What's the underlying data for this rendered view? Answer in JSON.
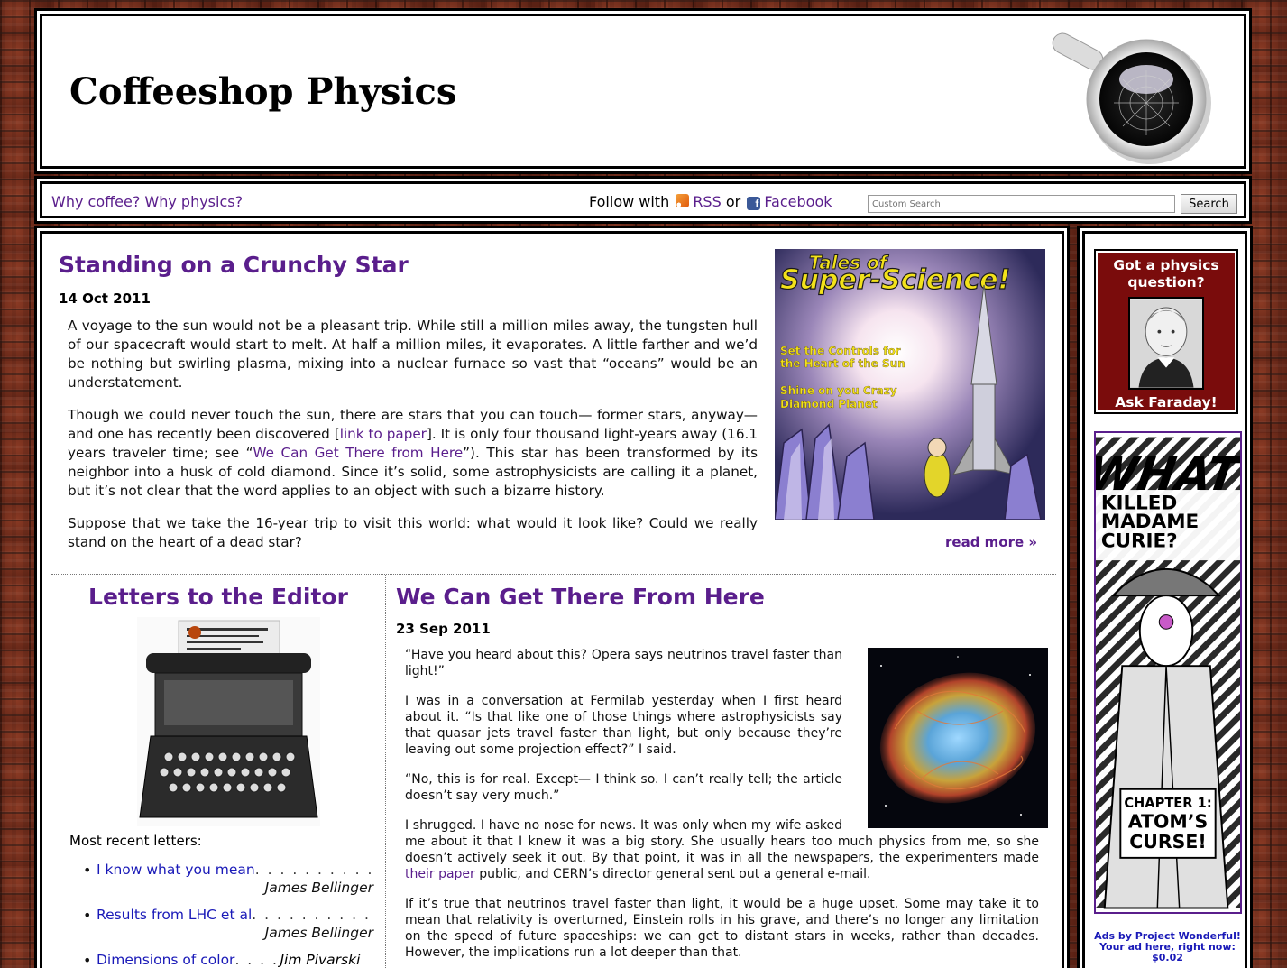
{
  "site": {
    "title": "Coffeeshop Physics"
  },
  "nav": {
    "why_link": "Why coffee? Why physics?",
    "follow_prefix": "Follow with",
    "rss_label": "RSS",
    "or_label": "or",
    "facebook_label": "Facebook",
    "search_placeholder": "Custom Search",
    "search_button": "Search"
  },
  "article1": {
    "title": "Standing on a Crunchy Star",
    "date": "14 Oct 2011",
    "p1": "A voyage to the sun would not be a pleasant trip. While still a million miles away, the tungsten hull of our spacecraft would start to melt. At half a million miles, it evaporates. A little farther and we’d be nothing but swirling plasma, mixing into a nuclear furnace so vast that “oceans” would be an understatement.",
    "p2_a": "Though we could never touch the sun, there are stars that you can touch— former stars, anyway— and one has recently been discovered [",
    "p2_link1": "link to paper",
    "p2_b": "]. It is only four thousand light-years away (16.1 years traveler time; see “",
    "p2_link2": "We Can Get There from Here",
    "p2_c": "”). This star has been transformed by its neighbor into a husk of cold diamond. Since it’s solid, some astrophysicists are calling it a planet, but it’s not clear that the word applies to an object with such a bizarre history.",
    "p3": "Suppose that we take the 16-year trip to visit this world: what would it look like? Could we really stand on the heart of a dead star?",
    "read_more": "read more »",
    "image": {
      "title_line1": "Tales of",
      "title_line2": "Super-Science!",
      "caption1_l1": "Set the Controls for",
      "caption1_l2": "the Heart of the Sun",
      "caption2_l1": "Shine on you Crazy",
      "caption2_l2": "Diamond Planet"
    }
  },
  "letters": {
    "title": "Letters to the Editor",
    "recent_label": "Most recent letters:",
    "items": [
      {
        "title": "I know what you mean",
        "author": "James Bellinger"
      },
      {
        "title": "Results from LHC et al",
        "author": "James Bellinger"
      },
      {
        "title": "Dimensions of color",
        "author": "Jim Pivarski"
      }
    ]
  },
  "article2": {
    "title": "We Can Get There From Here",
    "date": "23 Sep 2011",
    "p1": "“Have you heard about this? Opera says neutrinos travel faster than light!”",
    "p2": "I was in a conversation at Fermilab yesterday when I first heard about it. “Is that like one of those things where astrophysicists say that quasar jets travel faster than light, but only because they’re leaving out some projection effect?” I said.",
    "p3": "“No, this is for real. Except— I think so. I can’t really tell; the article doesn’t say very much.”",
    "p4_a": "I shrugged. I have no nose for news. It was only when my wife asked me about it that I knew it was a big story. She usually hears too much physics from me, so she doesn’t actively seek it out. By that point, it was in all the newspapers, the experimenters made ",
    "p4_link": "their paper",
    "p4_b": " public, and CERN’s director general sent out a general e-mail.",
    "p5": "If it’s true that neutrinos travel faster than light, it would be a huge upset. Some may take it to mean that relativity is overturned, Einstein rolls in his grave, and there’s no longer any limitation on the speed of future spaceships: we can get to distant stars in weeks, rather than decades. However, the implications run a lot deeper than that."
  },
  "sidebar": {
    "faraday_question": "Got a physics question?",
    "faraday_ask": "Ask Faraday!",
    "ad": {
      "line1": "WHAT",
      "line2": "KILLED",
      "line3": "MADAME",
      "line4": "CURIE?",
      "chapter": "CHAPTER 1:",
      "chapter_title_l1": "ATOM’S",
      "chapter_title_l2": "CURSE!"
    },
    "ad_credit_l1": "Ads by Project Wonderful!",
    "ad_credit_l2": "Your ad here, right now:",
    "ad_credit_l3": "$0.02"
  },
  "colors": {
    "accent": "#5a1e8c",
    "link_blue": "#1a1ab8",
    "faraday_bg": "#7a0c0c"
  }
}
